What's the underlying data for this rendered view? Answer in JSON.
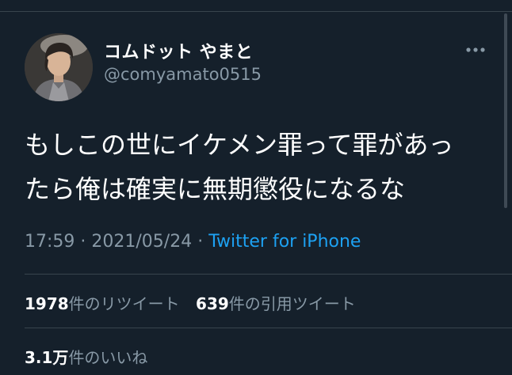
{
  "tweet": {
    "author": {
      "display_name": "コムドット やまと",
      "username": "@comyamato0515"
    },
    "more_icon": "more-horizontal-icon",
    "text_lines": [
      "もしこの世にイケメン罪って罪があっ",
      "たら俺は確実に無期懲役になるな"
    ],
    "time": "17:59",
    "date": "2021/05/24",
    "separator": "·",
    "source": "Twitter for iPhone"
  },
  "stats": {
    "retweets": {
      "count": "1978",
      "label": "件のリツイート"
    },
    "quotes": {
      "count": "639",
      "label": "件の引用ツイート"
    },
    "likes": {
      "count": "3.1万",
      "label": "件のいいね"
    }
  },
  "colors": {
    "background": "#15202b",
    "primary_text": "#ffffff",
    "secondary_text": "#8899a6",
    "link": "#1da1f2",
    "divider": "#38444d"
  }
}
